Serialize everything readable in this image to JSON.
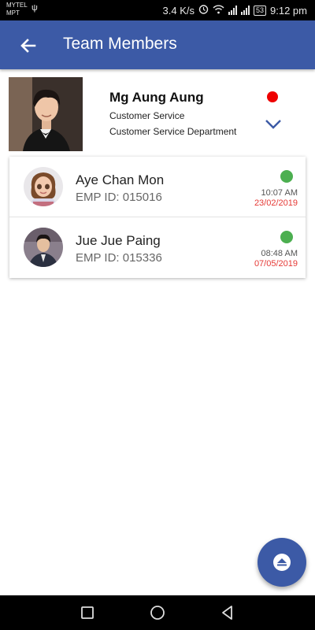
{
  "status_bar": {
    "carrier_1": "MYTEL",
    "carrier_2": "MPT",
    "speed": "3.4 K/s",
    "battery": "53",
    "time": "9:12 pm"
  },
  "app_bar": {
    "title": "Team Members",
    "back_icon": "arrow-left-icon"
  },
  "profile": {
    "name": "Mg Aung Aung",
    "role": "Customer Service",
    "department": "Customer Service Department",
    "status_color": "#ee0000",
    "expand_icon": "chevron-down-icon"
  },
  "members": [
    {
      "name": "Aye Chan Mon",
      "emp_id": "EMP ID: 015016",
      "status_color": "#4caf50",
      "time": "10:07 AM",
      "date": "23/02/2019"
    },
    {
      "name": "Jue Jue Paing",
      "emp_id": "EMP ID: 015336",
      "status_color": "#4caf50",
      "time": "08:48 AM",
      "date": "07/05/2019"
    }
  ],
  "fab": {
    "icon": "eject-icon"
  },
  "nav_bar": {
    "icons": [
      "recent-apps-icon",
      "home-icon",
      "back-triangle-icon"
    ]
  },
  "colors": {
    "primary": "#3c5aa6",
    "online": "#4caf50",
    "offline": "#ee0000",
    "date": "#e53935"
  }
}
